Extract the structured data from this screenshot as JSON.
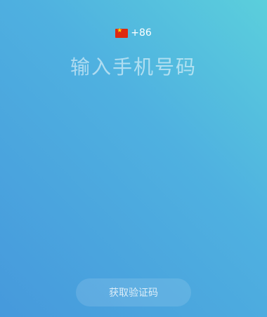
{
  "country": {
    "flag_icon": "china-flag-icon",
    "code": "+86"
  },
  "phone": {
    "placeholder": "输入手机号码",
    "value": ""
  },
  "actions": {
    "get_code_label": "获取验证码"
  },
  "colors": {
    "gradient_top_right": "#5bcfdc",
    "gradient_bottom_left": "#4699dc",
    "text": "#ffffff"
  }
}
